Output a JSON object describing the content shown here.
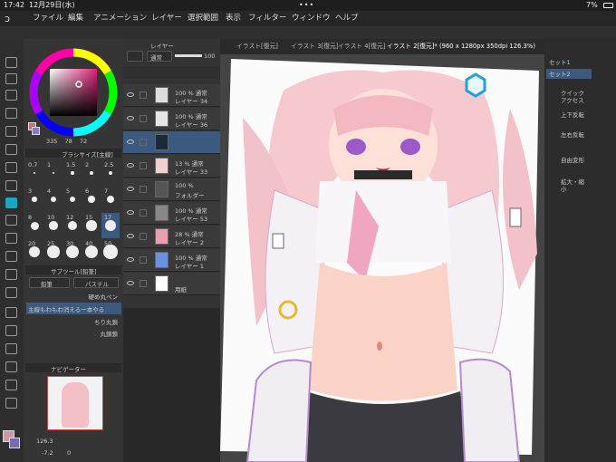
{
  "status": {
    "time": "17:42",
    "date": "12月29日(水)",
    "battery": "7%"
  },
  "menu": [
    "ファイル",
    "編集",
    "アニメーション",
    "レイヤー",
    "選択範囲",
    "表示",
    "フィルター",
    "ウィンドウ",
    "ヘルプ"
  ],
  "tabs": [
    "イラスト[復元]",
    "イラスト 3[復元]",
    "イラスト 4[復元]",
    "イラスト 2[復元]* (960 x 1280px 350dpi 126.3%)"
  ],
  "layer_panel": {
    "title": "レイヤー",
    "blend": "通常",
    "opacity": "100"
  },
  "layers": [
    {
      "opacity": "100 %",
      "mode": "通常",
      "name": "レイヤー 34"
    },
    {
      "opacity": "100 %",
      "mode": "通常",
      "name": "レイヤー 36"
    },
    {
      "opacity": "",
      "mode": "",
      "name": ""
    },
    {
      "opacity": "13 %",
      "mode": "通常",
      "name": "レイヤー 33"
    },
    {
      "opacity": "100 %",
      "mode": "",
      "name": "フォルダー"
    },
    {
      "opacity": "100 %",
      "mode": "通常",
      "name": "レイヤー 53"
    },
    {
      "opacity": "28 %",
      "mode": "通常",
      "name": "レイヤー 2"
    },
    {
      "opacity": "100 %",
      "mode": "通常",
      "name": "レイヤー 1"
    },
    {
      "opacity": "",
      "mode": "",
      "name": "用紙"
    }
  ],
  "color": {
    "values": [
      "335",
      "78",
      "72"
    ],
    "accent": "#e0a0c0"
  },
  "brush_size": {
    "title": "ブラシサイズ[主線]",
    "sizes": [
      "0.7",
      "1",
      "1.5",
      "2",
      "2.5",
      "3",
      "4",
      "5",
      "6",
      "7",
      "8",
      "10",
      "12",
      "15",
      "17",
      "20",
      "25",
      "30",
      "40",
      "50"
    ],
    "selected": "17"
  },
  "subtool": {
    "title": "サブツール[鉛筆]",
    "tabs": [
      "鉛筆",
      "パステル"
    ],
    "items": [
      "硬め丸ペン",
      "主線もわもわ消える一本やる",
      "ちり丸鎖",
      "丸鎖鎖"
    ]
  },
  "navigator": {
    "title": "ナビゲーター",
    "zoom": "126.3",
    "rotate": "-7.2",
    "zoom_btn": "0"
  },
  "right_panel": {
    "items": [
      "セット1",
      "セット2"
    ],
    "actions": [
      "クイックアクセス",
      "上下反転",
      "左右反転",
      "自由変形",
      "拡大・縮小"
    ]
  }
}
